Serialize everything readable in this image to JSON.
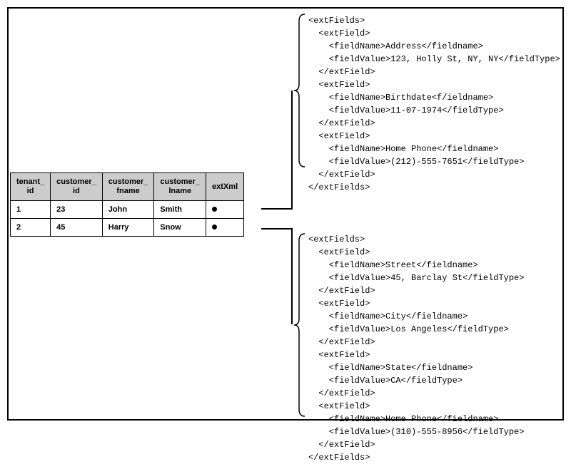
{
  "table": {
    "headers": {
      "tenant_id": "tenant_\nid",
      "customer_id": "customer_\nid",
      "customer_fname": "customer_\nfname",
      "customer_lname": "customer_\nlname",
      "extXml": "extXml"
    },
    "rows": [
      {
        "tenant_id": "1",
        "customer_id": "23",
        "customer_fname": "John",
        "customer_lname": "Smith"
      },
      {
        "tenant_id": "2",
        "customer_id": "45",
        "customer_fname": "Harry",
        "customer_lname": "Snow"
      }
    ]
  },
  "xml_top": {
    "lines": [
      "<extFields>",
      "  <extField>",
      "    <fieldName>Address</fieldname>",
      "    <fieldValue>123, Holly St, NY, NY</fieldType>",
      "  </extField>",
      "  <extField>",
      "    <fieldName>Birthdate<f/ieldname>",
      "    <fieldValue>11-07-1974</fieldType>",
      "  </extField>",
      "  <extField>",
      "    <fieldName>Home Phone</fieldname>",
      "    <fieldValue>(212)-555-7651</fieldType>",
      "  </extField>",
      "</extFields>"
    ]
  },
  "xml_bottom": {
    "lines": [
      "<extFields>",
      "  <extField>",
      "    <fieldName>Street</fieldname>",
      "    <fieldValue>45, Barclay St</fieldType>",
      "  </extField>",
      "  <extField>",
      "    <fieldName>City</fieldname>",
      "    <fieldValue>Los Angeles</fieldType>",
      "  </extField>",
      "  <extField>",
      "    <fieldName>State</fieldname>",
      "    <fieldValue>CA</fieldType>",
      "  </extField>",
      "  <extField>",
      "    <fieldName>Home Phone</fieldname>",
      "    <fieldValue>(310)-555-8956</fieldType>",
      "  </extField>",
      "</extFields>"
    ]
  }
}
